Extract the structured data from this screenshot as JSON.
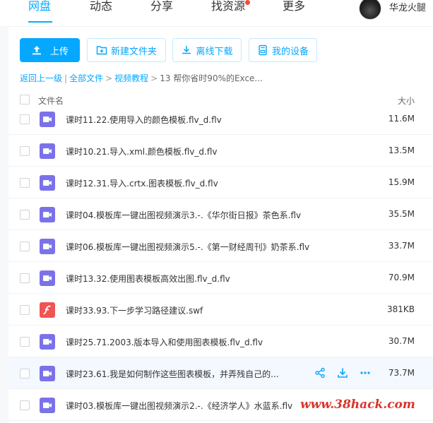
{
  "nav": {
    "items": [
      {
        "label": "网盘"
      },
      {
        "label": "动态"
      },
      {
        "label": "分享"
      },
      {
        "label": "找资源"
      },
      {
        "label": "更多"
      }
    ],
    "username": "华龙火腿",
    "accent": "#09aaff"
  },
  "toolbar": {
    "upload_label": "上传",
    "new_folder_label": "新建文件夹",
    "offline_download_label": "离线下载",
    "my_devices_label": "我的设备"
  },
  "breadcrumb": {
    "back": "返回上一级",
    "items": [
      "全部文件",
      "视频教程",
      "13 帮你省时90%的Exce..."
    ]
  },
  "table": {
    "col_name": "文件名",
    "col_size": "大小",
    "rows": [
      {
        "name": "课时11.22.使用导入的颜色模板.flv_d.flv",
        "size": "11.6M",
        "icon": "video-file-icon"
      },
      {
        "name": "课时10.21.导入.xml.颜色模板.flv_d.flv",
        "size": "13.5M",
        "icon": "video-file-icon"
      },
      {
        "name": "课时12.31.导入.crtx.图表模板.flv_d.flv",
        "size": "15.9M",
        "icon": "video-file-icon"
      },
      {
        "name": "课时04.模板库一键出图视频演示3.-.《华尔街日报》茶色系.flv",
        "size": "35.5M",
        "icon": "video-file-icon"
      },
      {
        "name": "课时06.模板库一键出图视频演示5.-.《第一财经周刊》奶茶系.flv",
        "size": "33.7M",
        "icon": "video-file-icon"
      },
      {
        "name": "课时13.32.使用图表模板高效出图.flv_d.flv",
        "size": "70.9M",
        "icon": "video-file-icon"
      },
      {
        "name": "课时33.93.下一步学习路径建议.swf",
        "size": "381KB",
        "icon": "flash-file-icon"
      },
      {
        "name": "课时25.71.2003.版本导入和使用图表模板.flv_d.flv",
        "size": "30.7M",
        "icon": "video-file-icon"
      },
      {
        "name": "课时23.61.我是如何制作这些图表模板，并弄残自己的...",
        "size": "73.7M",
        "icon": "video-file-icon"
      },
      {
        "name": "课时03.模板库一键出图视频演示2.-.《经济学人》水蓝系.flv",
        "size": "",
        "icon": "video-file-icon"
      }
    ]
  },
  "watermark": "www.38hack.com"
}
